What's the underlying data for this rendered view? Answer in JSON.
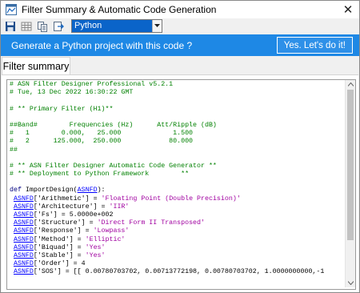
{
  "window": {
    "title": "Filter Summary & Automatic Code Generation"
  },
  "toolbar": {
    "language_value": "Python"
  },
  "banner": {
    "message": "Generate a Python project with this code ?",
    "button_label": "Yes. Let's do it!",
    "color": "#1e88e5"
  },
  "tabs": [
    {
      "label": "Filter summary"
    }
  ],
  "icons": [
    "app-icon",
    "save-icon",
    "grid-icon",
    "copy-icon",
    "export-icon",
    "close-icon",
    "chevron-down-icon"
  ],
  "code_lines": [
    [
      {
        "t": "# ASN Filter Designer Professional v5.2.1",
        "c": "cm"
      }
    ],
    [
      {
        "t": "# Tue, 13 Dec 2022 16:30:22 GMT",
        "c": "cm"
      }
    ],
    [
      {
        "t": "",
        "c": "pl"
      }
    ],
    [
      {
        "t": "# ** Primary Filter (H1)**",
        "c": "cm"
      }
    ],
    [
      {
        "t": "",
        "c": "pl"
      }
    ],
    [
      {
        "t": "##Band#        Frequencies (Hz)      Att/Ripple (dB)",
        "c": "cm"
      }
    ],
    [
      {
        "t": "#   1        0.000,   25.000             1.500",
        "c": "cm"
      }
    ],
    [
      {
        "t": "#   2      125.000,  250.000            80.000",
        "c": "cm"
      }
    ],
    [
      {
        "t": "##",
        "c": "cm"
      }
    ],
    [
      {
        "t": "",
        "c": "pl"
      }
    ],
    [
      {
        "t": "# ** ASN Filter Designer Automatic Code Generator **",
        "c": "cm"
      }
    ],
    [
      {
        "t": "# ** Deployment to Python Framework        **",
        "c": "cm"
      }
    ],
    [
      {
        "t": "",
        "c": "pl"
      }
    ],
    [
      {
        "t": "def ",
        "c": "kw"
      },
      {
        "t": "ImportDesign(",
        "c": "pl"
      },
      {
        "t": "ASNFD",
        "c": "vr"
      },
      {
        "t": "):",
        "c": "pl"
      }
    ],
    [
      {
        "t": " ",
        "c": "pl"
      },
      {
        "t": "ASNFD",
        "c": "vr"
      },
      {
        "t": "['Arithmetic'] = ",
        "c": "pl"
      },
      {
        "t": "'Floating Point (Double Precision)'",
        "c": "st"
      }
    ],
    [
      {
        "t": " ",
        "c": "pl"
      },
      {
        "t": "ASNFD",
        "c": "vr"
      },
      {
        "t": "['Architecture'] = ",
        "c": "pl"
      },
      {
        "t": "'IIR'",
        "c": "st"
      }
    ],
    [
      {
        "t": " ",
        "c": "pl"
      },
      {
        "t": "ASNFD",
        "c": "vr"
      },
      {
        "t": "['Fs'] = 5.0000e+002",
        "c": "pl"
      }
    ],
    [
      {
        "t": " ",
        "c": "pl"
      },
      {
        "t": "ASNFD",
        "c": "vr"
      },
      {
        "t": "['Structure'] = ",
        "c": "pl"
      },
      {
        "t": "'Direct Form II Transposed'",
        "c": "st"
      }
    ],
    [
      {
        "t": " ",
        "c": "pl"
      },
      {
        "t": "ASNFD",
        "c": "vr"
      },
      {
        "t": "['Response'] = ",
        "c": "pl"
      },
      {
        "t": "'Lowpass'",
        "c": "st"
      }
    ],
    [
      {
        "t": " ",
        "c": "pl"
      },
      {
        "t": "ASNFD",
        "c": "vr"
      },
      {
        "t": "['Method'] = ",
        "c": "pl"
      },
      {
        "t": "'Elliptic'",
        "c": "st"
      }
    ],
    [
      {
        "t": " ",
        "c": "pl"
      },
      {
        "t": "ASNFD",
        "c": "vr"
      },
      {
        "t": "['Biquad'] = ",
        "c": "pl"
      },
      {
        "t": "'Yes'",
        "c": "st"
      }
    ],
    [
      {
        "t": " ",
        "c": "pl"
      },
      {
        "t": "ASNFD",
        "c": "vr"
      },
      {
        "t": "['Stable'] = ",
        "c": "pl"
      },
      {
        "t": "'Yes'",
        "c": "st"
      }
    ],
    [
      {
        "t": " ",
        "c": "pl"
      },
      {
        "t": "ASNFD",
        "c": "vr"
      },
      {
        "t": "['Order'] = 4",
        "c": "pl"
      }
    ],
    [
      {
        "t": " ",
        "c": "pl"
      },
      {
        "t": "ASNFD",
        "c": "vr"
      },
      {
        "t": "['SOS'] = [[ 0.00780703702, 0.00713772198, 0.00780703702, 1.0000000000,-1",
        "c": "pl"
      }
    ]
  ]
}
